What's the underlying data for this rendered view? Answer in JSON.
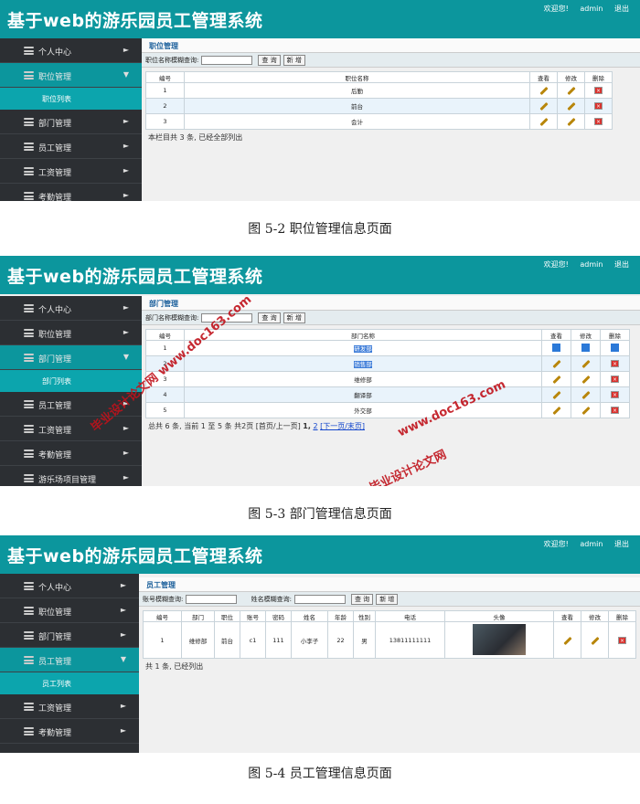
{
  "app": {
    "title": "基于web的游乐园员工管理系统",
    "welcome": "欢迎您!",
    "user": "admin",
    "logout": "退出"
  },
  "figures": [
    {
      "caption": "图 5-2 职位管理信息页面",
      "sidebar": [
        {
          "label": "个人中心",
          "arrow": "►"
        },
        {
          "label": "职位管理",
          "arrow": "▼",
          "active": true
        },
        {
          "label": "部门管理",
          "arrow": "►"
        },
        {
          "label": "员工管理",
          "arrow": "►"
        },
        {
          "label": "工资管理",
          "arrow": "►"
        },
        {
          "label": "考勤管理",
          "arrow": "►"
        }
      ],
      "submenu": "职位列表",
      "page_title": "职位管理",
      "search_label": "职位名称模糊查询:",
      "search_button": "查 询",
      "add_button": "新 增",
      "columns": [
        "编号",
        "职位名称",
        "查看",
        "修改",
        "删除"
      ],
      "rows": [
        [
          "1",
          "后勤"
        ],
        [
          "2",
          "前台"
        ],
        [
          "3",
          "会计"
        ]
      ],
      "footer": "本栏目共 3 条, 已经全部列出"
    },
    {
      "caption": "图 5-3 部门管理信息页面",
      "sidebar": [
        {
          "label": "个人中心",
          "arrow": "►"
        },
        {
          "label": "职位管理",
          "arrow": "►"
        },
        {
          "label": "部门管理",
          "arrow": "▼",
          "active": true
        },
        {
          "label": "员工管理",
          "arrow": "►"
        },
        {
          "label": "工资管理",
          "arrow": "►"
        },
        {
          "label": "考勤管理",
          "arrow": "►"
        },
        {
          "label": "游乐场项目管理",
          "arrow": "►"
        }
      ],
      "submenu": "部门列表",
      "page_title": "部门管理",
      "search_label": "部门名称模糊查询:",
      "search_button": "查 询",
      "add_button": "新 增",
      "columns": [
        "编号",
        "部门名称",
        "查看",
        "修改",
        "删除"
      ],
      "rows": [
        [
          "1",
          "研发部"
        ],
        [
          "2",
          "销售部"
        ],
        [
          "3",
          "维修部"
        ],
        [
          "4",
          "翻译部"
        ],
        [
          "5",
          "外交部"
        ]
      ],
      "footer_text": "总共 6 条, 当前 1 至 5 条 共2页 [首页/上一页]",
      "page_current": "1,",
      "page_next_num": "2",
      "page_links": "[下一页/末页]"
    },
    {
      "caption": "图 5-4 员工管理信息页面",
      "sidebar": [
        {
          "label": "个人中心",
          "arrow": "►"
        },
        {
          "label": "职位管理",
          "arrow": "►"
        },
        {
          "label": "部门管理",
          "arrow": "►"
        },
        {
          "label": "员工管理",
          "arrow": "▼",
          "active": true
        },
        {
          "label": "工资管理",
          "arrow": "►"
        },
        {
          "label": "考勤管理",
          "arrow": "►"
        }
      ],
      "submenu": "员工列表",
      "page_title": "员工管理",
      "search_label": "账号模糊查询:",
      "search_label2": "姓名模糊查询:",
      "search_button": "查 询",
      "add_button": "新 增",
      "columns": [
        "编号",
        "部门",
        "职位",
        "账号",
        "密码",
        "姓名",
        "年龄",
        "性别",
        "电话",
        "头像",
        "查看",
        "修改",
        "删除"
      ],
      "rows": [
        [
          "1",
          "维修部",
          "前台",
          "c1",
          "111",
          "小李子",
          "22",
          "男",
          "13811111111"
        ]
      ],
      "footer": "共 1 条, 已经列出"
    }
  ],
  "watermarks": [
    "毕业设计论文网",
    "www.doc163.com"
  ],
  "colors": {
    "header": "#0c969d",
    "sidebar": "#2c2f33",
    "active": "#0c969d",
    "delete": "#d9302c"
  }
}
